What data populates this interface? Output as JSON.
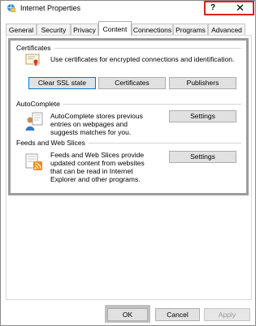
{
  "window": {
    "title": "Internet Properties"
  },
  "title_controls": {
    "help": "?",
    "close": "✕"
  },
  "tabs": [
    {
      "label": "General"
    },
    {
      "label": "Security"
    },
    {
      "label": "Privacy"
    },
    {
      "label": "Content"
    },
    {
      "label": "Connections"
    },
    {
      "label": "Programs"
    },
    {
      "label": "Advanced"
    }
  ],
  "certificates": {
    "heading": "Certificates",
    "description": "Use certificates for encrypted connections and identification.",
    "clear_ssl_label": "Clear SSL state",
    "certificates_label": "Certificates",
    "publishers_label": "Publishers"
  },
  "autocomplete": {
    "heading": "AutoComplete",
    "description": "AutoComplete stores previous entries on webpages and suggests matches for you.",
    "settings_label": "Settings"
  },
  "feeds": {
    "heading": "Feeds and Web Slices",
    "description": "Feeds and Web Slices provide updated content from websites that can be read in Internet Explorer and other programs.",
    "settings_label": "Settings"
  },
  "footer": {
    "ok_label": "OK",
    "cancel_label": "Cancel",
    "apply_label": "Apply"
  },
  "colors": {
    "focus_border": "#0078d7",
    "highlight_red": "#e02020"
  }
}
